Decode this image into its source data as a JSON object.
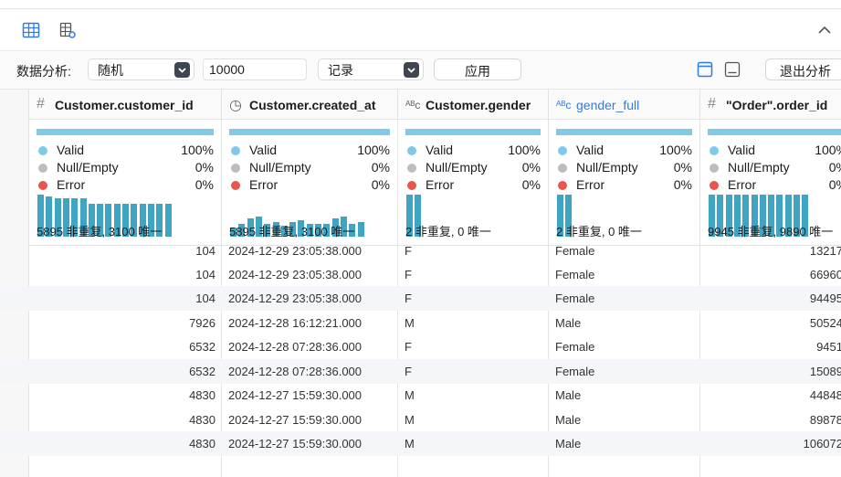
{
  "toolbar": {
    "analysis_label": "数据分析:",
    "mode_value": "随机",
    "count_value": "10000",
    "type_value": "记录",
    "apply_label": "应用",
    "exit_label": "退出分析"
  },
  "columns": [
    {
      "icon": "#",
      "name": "Customer.customer_id",
      "bars": [
        46,
        44,
        42,
        42,
        42,
        42,
        36,
        36,
        36,
        36,
        36,
        36,
        36,
        36,
        36,
        36
      ],
      "bar_count": 16,
      "footer": "5895 非重复, 3100 唯一",
      "stats": [
        {
          "label": "Valid",
          "value": "100%"
        },
        {
          "label": "Null/Empty",
          "value": "0%"
        },
        {
          "label": "Error",
          "value": "0%"
        }
      ]
    },
    {
      "icon": "◷",
      "name": "Customer.created_at",
      "bars": [
        10,
        14,
        20,
        22,
        14,
        16,
        12,
        16,
        18,
        14,
        14,
        14,
        20,
        22,
        14,
        16
      ],
      "bar_count": 16,
      "footer": "5895 非重复, 3100 唯一",
      "stats": [
        {
          "label": "Valid",
          "value": "100%"
        },
        {
          "label": "Null/Empty",
          "value": "0%"
        },
        {
          "label": "Error",
          "value": "0%"
        }
      ]
    },
    {
      "icon": "ᴬᴮc",
      "name": "Customer.gender",
      "bars": [
        46,
        46
      ],
      "bar_count": 2,
      "footer": "2 非重复, 0 唯一",
      "stats": [
        {
          "label": "Valid",
          "value": "100%"
        },
        {
          "label": "Null/Empty",
          "value": "0%"
        },
        {
          "label": "Error",
          "value": "0%"
        }
      ]
    },
    {
      "icon": "ᴬᴮc",
      "name": "gender_full",
      "bars": [
        46,
        46
      ],
      "bar_count": 2,
      "footer": "2 非重复, 0 唯一",
      "stats": [
        {
          "label": "Valid",
          "value": "100%"
        },
        {
          "label": "Null/Empty",
          "value": "0%"
        },
        {
          "label": "Error",
          "value": "0%"
        }
      ]
    },
    {
      "icon": "#",
      "name": "\"Order\".order_id",
      "bars": [
        46,
        46,
        46,
        46,
        46,
        46,
        46,
        46,
        46,
        46,
        46,
        46
      ],
      "bar_count": 12,
      "footer": "9945 非重复, 9890 唯一",
      "stats": [
        {
          "label": "Valid",
          "value": "100%"
        },
        {
          "label": "Null/Empty",
          "value": "0%"
        },
        {
          "label": "Error",
          "value": "0%"
        }
      ]
    }
  ],
  "rows": [
    [
      "104",
      "2024-12-29 23:05:38.000",
      "F",
      "Female",
      "13217"
    ],
    [
      "104",
      "2024-12-29 23:05:38.000",
      "F",
      "Female",
      "66960"
    ],
    [
      "104",
      "2024-12-29 23:05:38.000",
      "F",
      "Female",
      "94495"
    ],
    [
      "7926",
      "2024-12-28 16:12:21.000",
      "M",
      "Male",
      "50524"
    ],
    [
      "6532",
      "2024-12-28 07:28:36.000",
      "F",
      "Female",
      "9451"
    ],
    [
      "6532",
      "2024-12-28 07:28:36.000",
      "F",
      "Female",
      "15089"
    ],
    [
      "4830",
      "2024-12-27 15:59:30.000",
      "M",
      "Male",
      "44848"
    ],
    [
      "4830",
      "2024-12-27 15:59:30.000",
      "M",
      "Male",
      "89878"
    ],
    [
      "4830",
      "2024-12-27 15:59:30.000",
      "M",
      "Male",
      "106072"
    ]
  ],
  "colors": {
    "valid": "#7fcae8",
    "null": "#bdbdbd",
    "error": "#e8574f",
    "bar": "#3ea5c3",
    "accent_header": "#2f7de1"
  }
}
